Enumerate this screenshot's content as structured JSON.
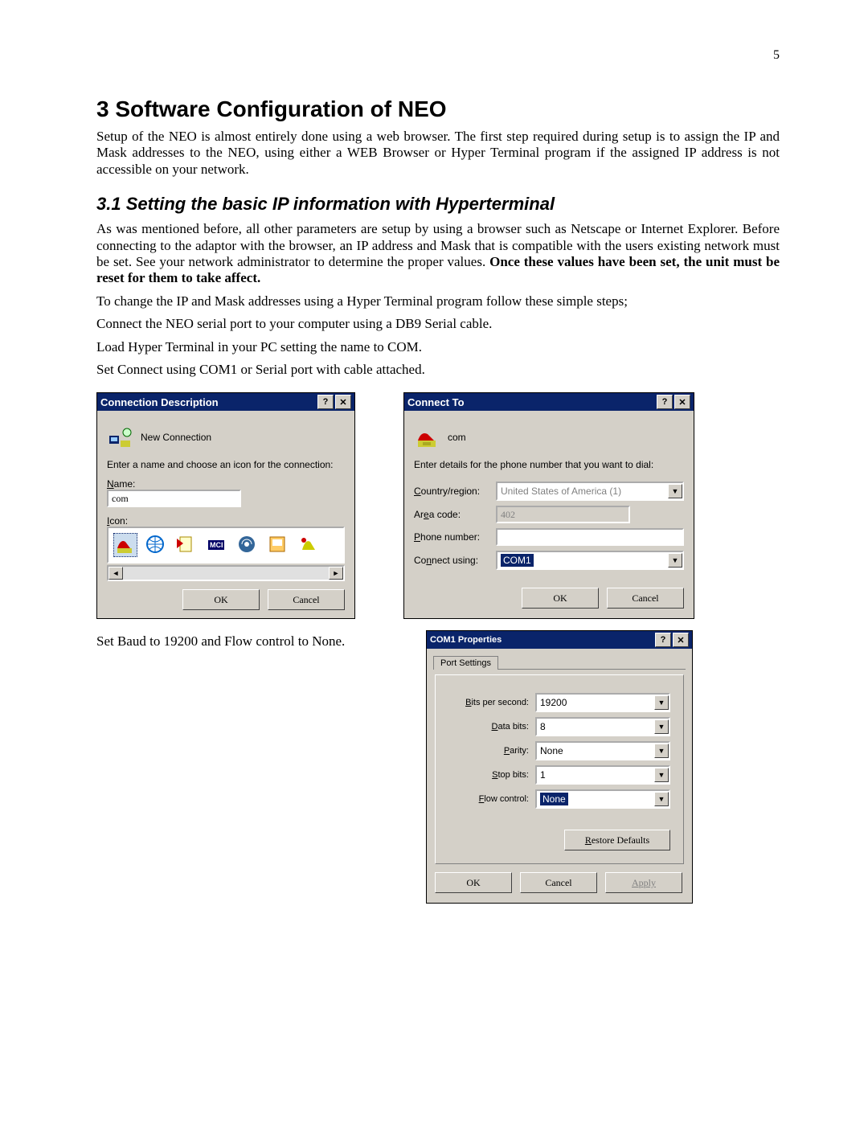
{
  "page_number": "5",
  "h1": "3  Software Configuration of NEO",
  "p_intro": "Setup of the NEO is almost entirely done using a web browser.  The first step required during setup is to assign the IP and Mask addresses to the NEO, using either a WEB Browser or Hyper Terminal program if the assigned IP address is not accessible on your network.",
  "h2": "3.1  Setting the basic IP information with Hyperterminal",
  "p_sub": "As was mentioned before, all other parameters are setup by using a browser such as Netscape or Internet Explorer. Before connecting to the adaptor with the browser, an IP address and Mask that is compatible with the users existing network must be set.  See your network administrator to determine the proper values.  ",
  "p_sub_bold": "Once these values have been set, the unit must be reset for them to take affect.",
  "p_step1": "To change the IP and Mask addresses using a Hyper Terminal program follow these simple steps;",
  "p_step2": "Connect the NEO serial port to your computer using a DB9 Serial cable.",
  "p_step3": "Load Hyper Terminal in your PC setting the name to COM.",
  "p_step4": "Set Connect using COM1 or Serial port with cable attached.",
  "p_step5": "Set Baud to 19200 and Flow control to None.",
  "dlg1": {
    "title": "Connection Description",
    "subtitle": "New Connection",
    "instruction": "Enter a name and choose an icon for the connection:",
    "name_label": "Name:",
    "name_value": "com",
    "icon_label": "Icon:",
    "ok": "OK",
    "cancel": "Cancel"
  },
  "dlg2": {
    "title": "Connect To",
    "subtitle": "com",
    "instruction": "Enter details for the phone number that you want to dial:",
    "country_label": "Country/region:",
    "country_value": "United States of America (1)",
    "area_label": "Area code:",
    "area_value": "402",
    "phone_label": "Phone number:",
    "phone_value": "",
    "connect_label": "Connect using:",
    "connect_value": "COM1",
    "ok": "OK",
    "cancel": "Cancel"
  },
  "dlg3": {
    "title": "COM1 Properties",
    "tab": "Port Settings",
    "bits_label": "Bits per second:",
    "bits_value": "19200",
    "data_label": "Data bits:",
    "data_value": "8",
    "parity_label": "Parity:",
    "parity_value": "None",
    "stop_label": "Stop bits:",
    "stop_value": "1",
    "flow_label": "Flow control:",
    "flow_value": "None",
    "restore": "Restore Defaults",
    "ok": "OK",
    "cancel": "Cancel",
    "apply": "Apply"
  }
}
